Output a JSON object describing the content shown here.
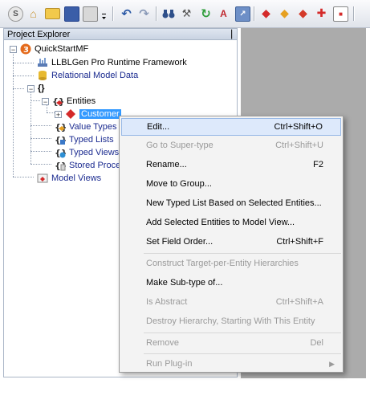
{
  "panel": {
    "title": "Project Explorer",
    "pin": "▕"
  },
  "toolbar": {
    "buttons": [
      {
        "name": "logo",
        "glyph": "S"
      },
      {
        "name": "home",
        "glyph": "⌂"
      },
      {
        "name": "open-folder",
        "glyph": "▭"
      },
      {
        "name": "save",
        "glyph": "▣"
      },
      {
        "name": "print",
        "glyph": "▤"
      },
      {
        "name": "undo",
        "glyph": "↶"
      },
      {
        "name": "redo",
        "glyph": "↷"
      },
      {
        "name": "binoculars",
        "glyph": "⚓"
      },
      {
        "name": "tools",
        "glyph": "⚒"
      },
      {
        "name": "refresh",
        "glyph": "↻"
      },
      {
        "name": "validate",
        "glyph": "A"
      },
      {
        "name": "deploy",
        "glyph": "↗"
      },
      {
        "name": "shield-red",
        "glyph": "◆"
      },
      {
        "name": "shield-yellow",
        "glyph": "◆"
      },
      {
        "name": "shield-multi",
        "glyph": "◆"
      },
      {
        "name": "move",
        "glyph": "✚"
      },
      {
        "name": "export",
        "glyph": "■"
      }
    ]
  },
  "tree": {
    "root": "QuickStartMF",
    "framework": "LLBLGen Pro Runtime Framework",
    "relational": "Relational Model Data",
    "group": "{}",
    "entities": "Entities",
    "customer": "Customer",
    "value_types": "Value Types",
    "typed_lists": "Typed Lists",
    "typed_views": "Typed Views",
    "stored_procs": "Stored Proce",
    "model_views": "Model Views",
    "expander_minus": "−",
    "expander_plus": "+"
  },
  "menu": {
    "items": [
      {
        "label": "Edit...",
        "shortcut": "Ctrl+Shift+O",
        "state": "highlighted"
      },
      {
        "label": "Go to Super-type",
        "shortcut": "Ctrl+Shift+U",
        "state": "disabled"
      },
      {
        "label": "Rename...",
        "shortcut": "F2",
        "state": "enabled"
      },
      {
        "label": "Move to Group...",
        "shortcut": "",
        "state": "enabled"
      },
      {
        "label": "New Typed List Based on Selected Entities...",
        "shortcut": "",
        "state": "enabled"
      },
      {
        "label": "Add Selected Entities to Model View...",
        "shortcut": "",
        "state": "enabled"
      },
      {
        "label": "Set Field Order...",
        "shortcut": "Ctrl+Shift+F",
        "state": "enabled"
      },
      {
        "label": "Construct Target-per-Entity Hierarchies",
        "shortcut": "",
        "state": "disabled"
      },
      {
        "label": "Make Sub-type of...",
        "shortcut": "",
        "state": "enabled"
      },
      {
        "label": "Is Abstract",
        "shortcut": "Ctrl+Shift+A",
        "state": "disabled"
      },
      {
        "label": "Destroy Hierarchy, Starting With This Entity",
        "shortcut": "",
        "state": "disabled"
      },
      {
        "label": "Remove",
        "shortcut": "Del",
        "state": "disabled"
      },
      {
        "label": "Run Plug-in",
        "shortcut": "",
        "state": "disabled"
      }
    ],
    "submenu_arrow": "▶"
  },
  "colors": {
    "accent": "#3399ff",
    "highlight": "#dde9fb",
    "disabled": "#9a9a9a",
    "link": "#1b2b90"
  }
}
